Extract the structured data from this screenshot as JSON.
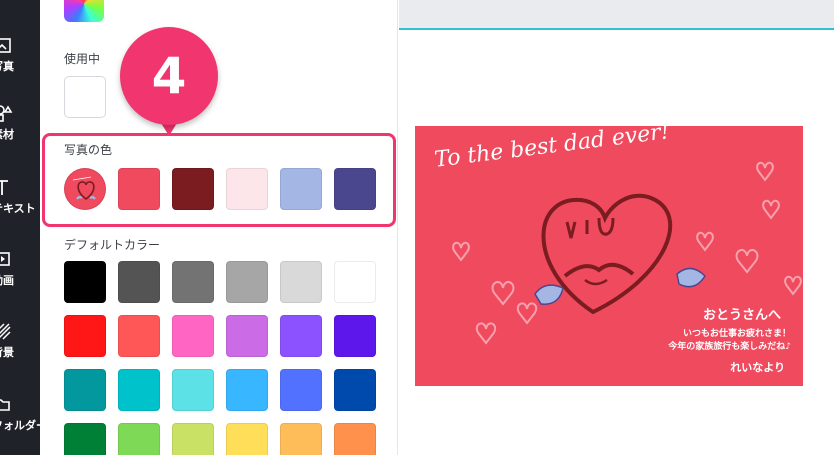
{
  "rail": {
    "items": [
      {
        "label": "写真",
        "icon": "image-icon"
      },
      {
        "label": "素材",
        "icon": "shapes-icon"
      },
      {
        "label": "テキスト",
        "icon": "text-icon"
      },
      {
        "label": "動画",
        "icon": "video-icon"
      },
      {
        "label": "背景",
        "icon": "pattern-icon"
      },
      {
        "label": "フォルダー",
        "icon": "folder-icon"
      }
    ]
  },
  "panel": {
    "used_colors_title": "使用中",
    "photo_colors_title": "写真の色",
    "photo_colors": [
      "#ef4a5e",
      "#7a1c20",
      "#fde6ea",
      "#a3b6e4",
      "#4b478f"
    ],
    "default_colors_title": "デフォルトカラー",
    "default_colors": [
      "#000000",
      "#545454",
      "#737373",
      "#a6a6a6",
      "#d9d9d9",
      "#ffffff",
      "#ff1616",
      "#ff5757",
      "#ff66c4",
      "#cb6ce6",
      "#8c52ff",
      "#5e17eb",
      "#03989e",
      "#00c2cb",
      "#5ce1e6",
      "#38b6ff",
      "#5271ff",
      "#004aad",
      "#008037",
      "#7ed957",
      "#c9e265",
      "#ffde59",
      "#ffbd59",
      "#ff914d"
    ]
  },
  "callout": {
    "number": "4"
  },
  "card": {
    "title": "To the best dad ever!",
    "line1": "おとうさんへ",
    "line2": "いつもお仕事お疲れさま！",
    "line3": "今年の家族旅行も楽しみだね♪",
    "signature": "れいなより",
    "background": "#ef4a5e"
  },
  "colors": {
    "accent": "#f0356f",
    "canvas_border": "#2ec4cf",
    "rail": "#1f2329"
  }
}
